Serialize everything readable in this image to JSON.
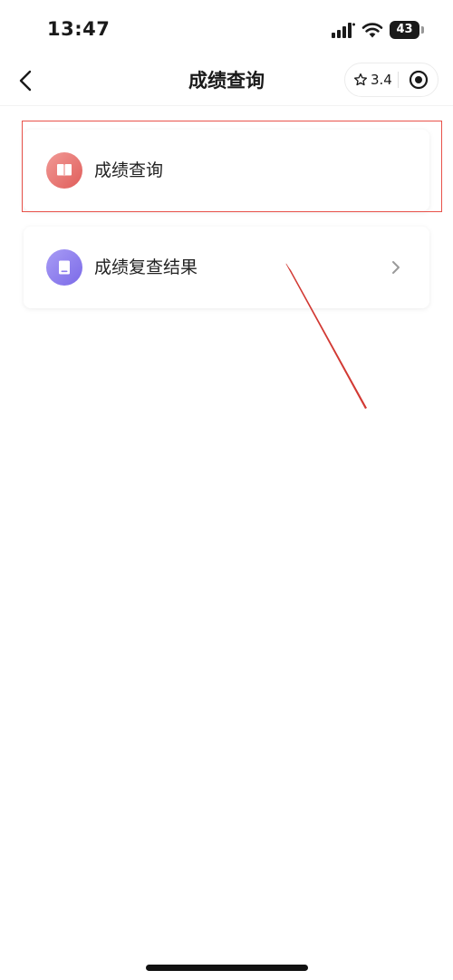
{
  "status_bar": {
    "time": "13:47",
    "battery": "43"
  },
  "nav": {
    "title": "成绩查询",
    "rating": "3.4",
    "back_icon": "chevron-left-icon",
    "star_icon": "star-outline-icon",
    "capsule_icon": "target-icon"
  },
  "cards": [
    {
      "label": "成绩查询",
      "icon": "open-book-icon",
      "icon_color": "#e86a66",
      "has_chevron": false,
      "highlighted": true
    },
    {
      "label": "成绩复查结果",
      "icon": "book-icon",
      "icon_color": "#8b7bee",
      "has_chevron": true
    }
  ],
  "colors": {
    "highlight_box": "#e8524a",
    "annotation_arrow": "#d23a34"
  }
}
